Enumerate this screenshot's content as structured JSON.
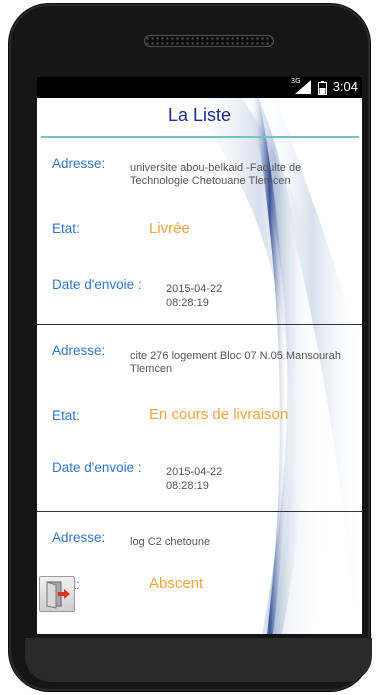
{
  "status_bar": {
    "network_type": "3G",
    "time": "3:04",
    "icons": [
      "signal-icon",
      "battery-icon"
    ]
  },
  "header": {
    "title": "La Liste"
  },
  "labels": {
    "address": "Adresse:",
    "state": "Etat:",
    "date": "Date d'envoie :"
  },
  "orders": [
    {
      "address": "universite abou-belkaid -Faculte de Technologie Chetouane Tlemcen",
      "state": "Livrée",
      "date": "2015-04-22",
      "time": "08:28:19"
    },
    {
      "address": "cite 276 logement Bloc 07 N.05 Mansourah Tlemcen",
      "state": "En cours de livraison",
      "date": "2015-04-22",
      "time": "08:28:19"
    },
    {
      "address": "log C2 chetoune",
      "state": "Abscent"
    }
  ],
  "colors": {
    "label_blue": "#2f74c8",
    "state_orange": "#f2a33c",
    "title_navy": "#1f2a8c",
    "accent_teal": "#6fc5c2"
  },
  "exit_button": {
    "icon": "exit-door-icon"
  }
}
